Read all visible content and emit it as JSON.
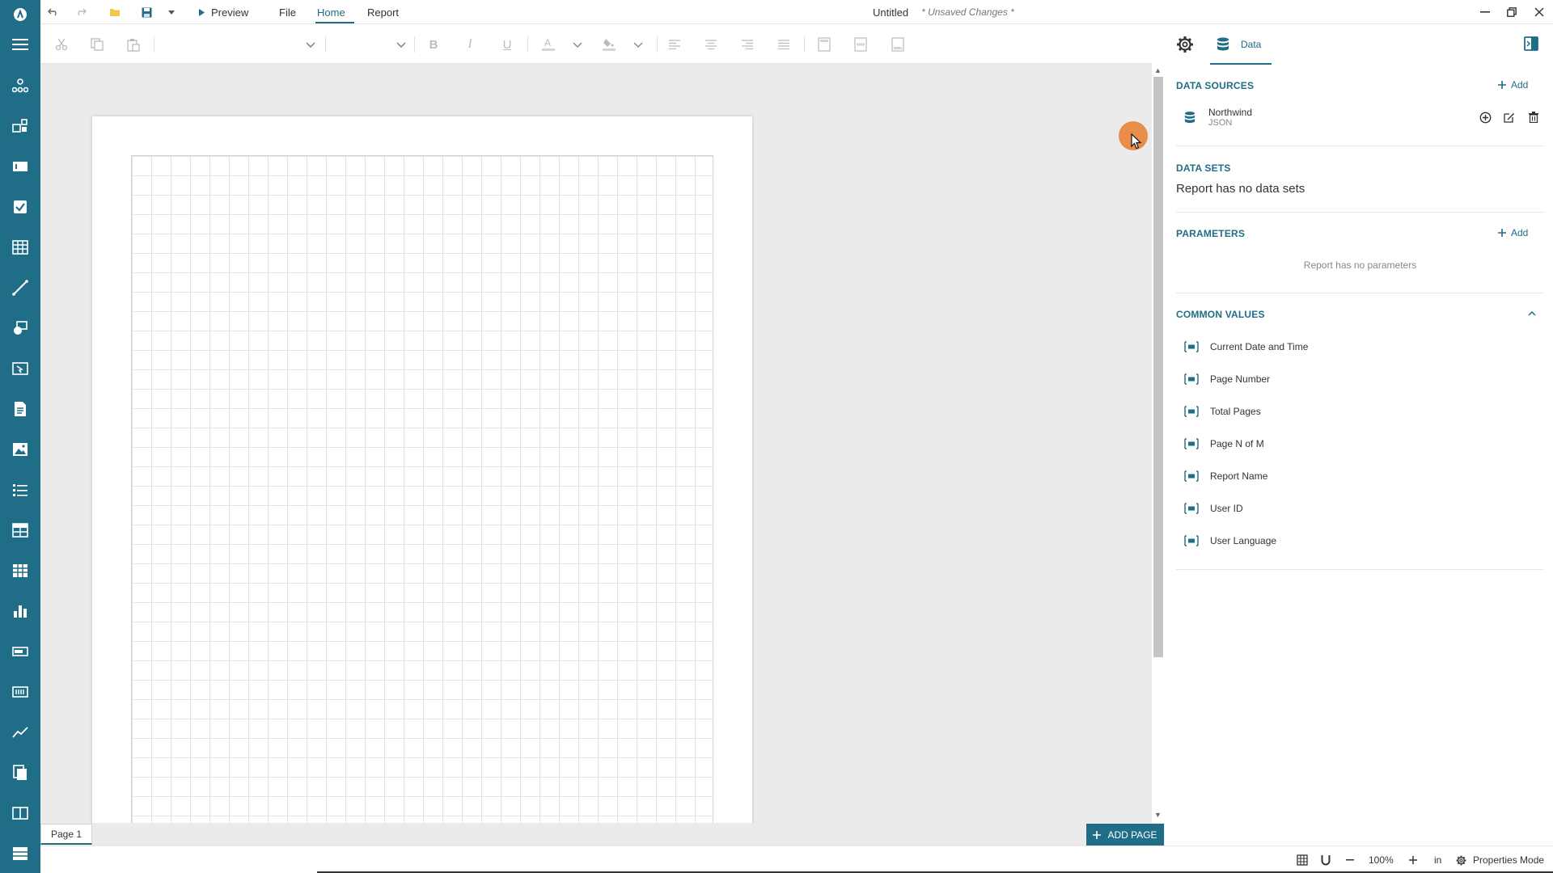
{
  "menu": {
    "preview": "Preview",
    "file": "File",
    "home": "Home",
    "report": "Report"
  },
  "document": {
    "title": "Untitled",
    "unsaved": "* Unsaved Changes *"
  },
  "right_panel": {
    "data_tab": "Data",
    "data_sources": {
      "title": "DATA SOURCES",
      "add": "Add",
      "items": [
        {
          "name": "Northwind",
          "type": "JSON"
        }
      ]
    },
    "data_sets": {
      "title": "DATA SETS",
      "empty": "Report has no data sets"
    },
    "parameters": {
      "title": "PARAMETERS",
      "add": "Add",
      "empty": "Report has no parameters"
    },
    "common_values": {
      "title": "COMMON VALUES",
      "items": [
        "Current Date and Time",
        "Page Number",
        "Total Pages",
        "Page N of M",
        "Report Name",
        "User ID",
        "User Language"
      ]
    }
  },
  "page_tabs": {
    "page1": "Page 1",
    "add_page": "ADD PAGE"
  },
  "statusbar": {
    "zoom": "100%",
    "units": "in",
    "mode": "Properties Mode"
  },
  "colors": {
    "accent": "#1f6d87",
    "cursor": "#e77c2e",
    "canvas": "#ebebeb"
  }
}
